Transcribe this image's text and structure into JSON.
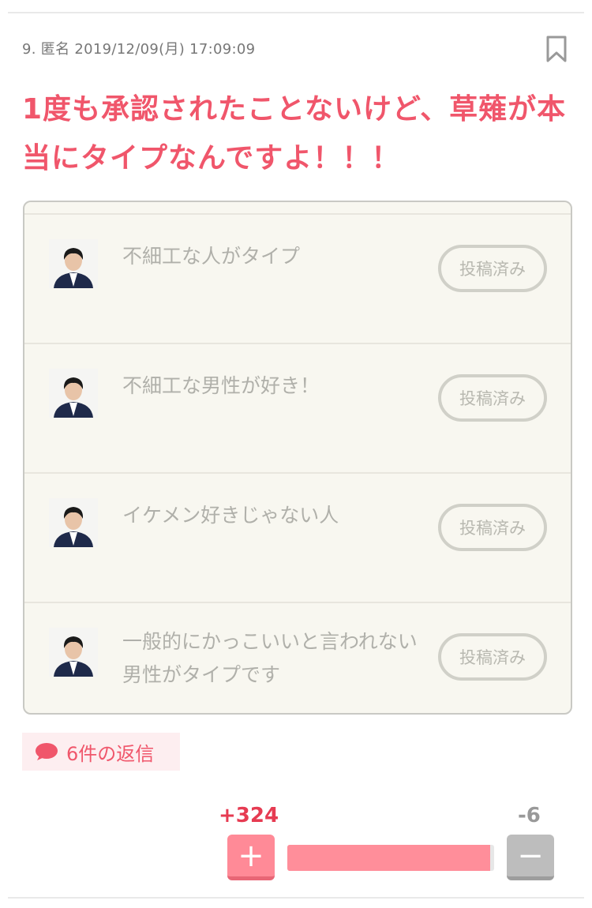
{
  "comment": {
    "meta": "9. 匿名 2019/12/09(月) 17:09:09",
    "title": "1度も承認されたことないけど、草薙が本当にタイプなんですよ！！！"
  },
  "topics": [
    {
      "text": "不細工な人がタイプ",
      "status": "投稿済み"
    },
    {
      "text": "不細工な男性が好き！",
      "status": "投稿済み"
    },
    {
      "text": "イケメン好きじゃない人",
      "status": "投稿済み"
    },
    {
      "text": "一般的にかっこいいと言われない男性がタイプです",
      "status": "投稿済み"
    }
  ],
  "replies": {
    "label": "6件の返信"
  },
  "votes": {
    "plus": "+324",
    "minus": "-6",
    "plus_symbol": "+",
    "minus_symbol": "−",
    "plus_ratio": 0.982
  },
  "colors": {
    "accent": "#f0566b",
    "plus": "#ff8a97",
    "minus": "#bdbdbd"
  },
  "icons": {
    "bookmark": "bookmark-icon",
    "reply": "speech-bubble-icon"
  }
}
